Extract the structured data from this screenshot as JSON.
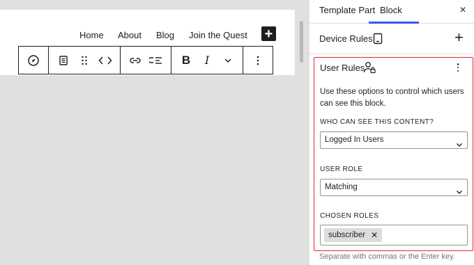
{
  "editor": {
    "nav": [
      "Home",
      "About",
      "Blog",
      "Join the Quest"
    ],
    "add_block": "+"
  },
  "toolbar": {
    "groups": [
      [
        "compass-icon"
      ],
      [
        "paragraph-icon",
        "drag-handle-icon",
        "code-arrows-icon"
      ],
      [
        "link-icon",
        "list-indent-icon"
      ],
      [
        "bold",
        "italic",
        "chevron-down-icon"
      ],
      [
        "more-options-icon"
      ]
    ],
    "bold_label": "B",
    "italic_label": "I"
  },
  "sidebar": {
    "tabs": [
      "Template Part",
      "Block"
    ],
    "active_tab": "Block",
    "close": "×",
    "device_rules": {
      "title": "Device Rules",
      "add": "+"
    },
    "user_rules": {
      "title": "User Rules",
      "description": "Use these options to control which users can see this block.",
      "who_label": "WHO CAN SEE THIS CONTENT?",
      "who_value": "Logged In Users",
      "role_label": "USER ROLE",
      "role_value": "Matching",
      "chosen_label": "CHOSEN ROLES",
      "chosen_tokens": [
        "subscriber"
      ],
      "token_remove": "✕",
      "hint": "Separate with commas or the Enter key."
    }
  },
  "colors": {
    "accent": "#3858e9",
    "highlight_border": "#e0282e",
    "canvas_bg": "#e0e0e0"
  }
}
